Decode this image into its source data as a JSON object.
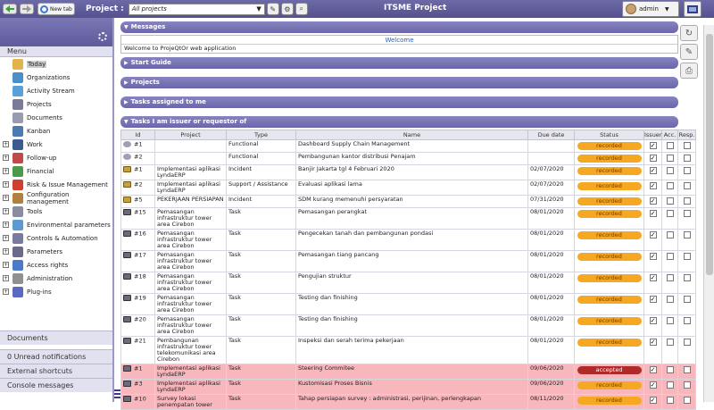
{
  "topbar": {
    "new_tab_label": "New tab",
    "project_label": "Project :",
    "project_value": "All projects",
    "app_title": "ITSME Project",
    "user_name": "admin"
  },
  "menu": {
    "title": "Menu",
    "items": [
      {
        "label": "Today",
        "icon": "today-icon",
        "expandable": false,
        "color": "#e2b34a"
      },
      {
        "label": "Organizations",
        "icon": "organizations-icon",
        "expandable": false,
        "color": "#4a8fc8"
      },
      {
        "label": "Activity Stream",
        "icon": "activity-stream-icon",
        "expandable": false,
        "color": "#5aa0d8"
      },
      {
        "label": "Projects",
        "icon": "projects-icon",
        "expandable": false,
        "color": "#7a7a9a"
      },
      {
        "label": "Documents",
        "icon": "documents-icon",
        "expandable": false,
        "color": "#9a9ab0"
      },
      {
        "label": "Kanban",
        "icon": "kanban-icon",
        "expandable": false,
        "color": "#4a7ab0"
      },
      {
        "label": "Work",
        "icon": "work-icon",
        "expandable": true,
        "color": "#3a5a90"
      },
      {
        "label": "Follow-up",
        "icon": "follow-up-icon",
        "expandable": true,
        "color": "#c04a4a"
      },
      {
        "label": "Financial",
        "icon": "financial-icon",
        "expandable": true,
        "color": "#4a9a4a"
      },
      {
        "label": "Risk & Issue Management",
        "icon": "risk-icon",
        "expandable": true,
        "color": "#d04030"
      },
      {
        "label": "Configuration management",
        "icon": "configuration-icon",
        "expandable": true,
        "color": "#b08040"
      },
      {
        "label": "Tools",
        "icon": "tools-icon",
        "expandable": true,
        "color": "#8a8aa0"
      },
      {
        "label": "Environmental parameters",
        "icon": "environmental-icon",
        "expandable": true,
        "color": "#5a9ad0"
      },
      {
        "label": "Controls & Automation",
        "icon": "controls-icon",
        "expandable": true,
        "color": "#7a7aa0"
      },
      {
        "label": "Parameters",
        "icon": "parameters-icon",
        "expandable": true,
        "color": "#6a6a8a"
      },
      {
        "label": "Access rights",
        "icon": "access-rights-icon",
        "expandable": true,
        "color": "#4a7ac8"
      },
      {
        "label": "Administration",
        "icon": "administration-icon",
        "expandable": true,
        "color": "#909090"
      },
      {
        "label": "Plug-ins",
        "icon": "plug-ins-icon",
        "expandable": true,
        "color": "#5a6ac0"
      }
    ]
  },
  "left_bottom": {
    "documents": "Documents",
    "unread": "0 Unread notifications",
    "shortcuts": "External shortcuts",
    "console": "Console messages"
  },
  "sections": {
    "messages": "Messages",
    "welcome": "Welcome",
    "welcome_text": "Welcome to ProjeQtOr web application",
    "start_guide": "Start Guide",
    "projects": "Projects",
    "tasks_assigned": "Tasks assigned to me",
    "tasks_issuer": "Tasks I am issuer or requestor of"
  },
  "table": {
    "headers": [
      "Id",
      "Project",
      "Type",
      "Name",
      "Due date",
      "Status",
      "Issuer",
      "Acc.",
      "Resp."
    ],
    "rows": [
      {
        "id": "#1",
        "icon": "functional",
        "project": "",
        "type": "Functional",
        "name": "Dashboard Supply Chain Management",
        "due": "",
        "status": "recorded",
        "issuer": true,
        "acc": false,
        "resp": false,
        "highlight": false
      },
      {
        "id": "#2",
        "icon": "functional",
        "project": "",
        "type": "Functional",
        "name": "Pembangunan kantor distribusi Penajam",
        "due": "",
        "status": "recorded",
        "issuer": true,
        "acc": false,
        "resp": false,
        "highlight": false
      },
      {
        "id": "#1",
        "icon": "incident",
        "project": "Implementasi aplikasi LyndaERP",
        "type": "Incident",
        "name": "Banjir Jakarta tgl 4 Februari 2020",
        "due": "02/07/2020",
        "status": "recorded",
        "issuer": true,
        "acc": false,
        "resp": false,
        "highlight": false
      },
      {
        "id": "#2",
        "icon": "incident",
        "project": "Implementasi aplikasi LyndaERP",
        "type": "Support / Assistance",
        "name": "Evaluasi aplikasi lama",
        "due": "02/07/2020",
        "status": "recorded",
        "issuer": true,
        "acc": false,
        "resp": false,
        "highlight": false
      },
      {
        "id": "#5",
        "icon": "incident",
        "project": "PEKERJAAN PERSIAPAN",
        "type": "Incident",
        "name": "SDM kurang memenuhi persyaratan",
        "due": "07/31/2020",
        "status": "recorded",
        "issuer": true,
        "acc": false,
        "resp": false,
        "highlight": false
      },
      {
        "id": "#15",
        "icon": "task",
        "project": "Pemasangan infrastruktur tower area Cirebon",
        "type": "Task",
        "name": "Pemasangan perangkat",
        "due": "08/01/2020",
        "status": "recorded",
        "issuer": true,
        "acc": false,
        "resp": false,
        "highlight": false
      },
      {
        "id": "#16",
        "icon": "task",
        "project": "Pemasangan infrastruktur tower area Cirebon",
        "type": "Task",
        "name": "Pengecekan tanah dan pembangunan pondasi",
        "due": "08/01/2020",
        "status": "recorded",
        "issuer": true,
        "acc": false,
        "resp": false,
        "highlight": false
      },
      {
        "id": "#17",
        "icon": "task",
        "project": "Pemasangan infrastruktur tower area Cirebon",
        "type": "Task",
        "name": "Pemasangan tiang pancang",
        "due": "08/01/2020",
        "status": "recorded",
        "issuer": true,
        "acc": false,
        "resp": false,
        "highlight": false
      },
      {
        "id": "#18",
        "icon": "task",
        "project": "Pemasangan infrastruktur tower area Cirebon",
        "type": "Task",
        "name": "Pengujian struktur",
        "due": "08/01/2020",
        "status": "recorded",
        "issuer": true,
        "acc": false,
        "resp": false,
        "highlight": false
      },
      {
        "id": "#19",
        "icon": "task",
        "project": "Pemasangan infrastruktur tower area Cirebon",
        "type": "Task",
        "name": "Testing dan finishing",
        "due": "08/01/2020",
        "status": "recorded",
        "issuer": true,
        "acc": false,
        "resp": false,
        "highlight": false
      },
      {
        "id": "#20",
        "icon": "task",
        "project": "Pemasangan infrastruktur tower area Cirebon",
        "type": "Task",
        "name": "Testing dan finishing",
        "due": "08/01/2020",
        "status": "recorded",
        "issuer": true,
        "acc": false,
        "resp": false,
        "highlight": false
      },
      {
        "id": "#21",
        "icon": "task",
        "project": "Pembangunan infrastruktur tower telekomunikasi area Cirebon",
        "type": "Task",
        "name": "Inspeksi dan serah terima pekerjaan",
        "due": "08/01/2020",
        "status": "recorded",
        "issuer": true,
        "acc": false,
        "resp": false,
        "highlight": false
      },
      {
        "id": "#1",
        "icon": "task",
        "project": "Implementasi aplikasi LyndaERP",
        "type": "Task",
        "name": "Steering Commitee",
        "due": "09/06/2020",
        "status": "accepted",
        "issuer": true,
        "acc": false,
        "resp": false,
        "highlight": true
      },
      {
        "id": "#3",
        "icon": "task",
        "project": "Implementasi aplikasi LyndaERP",
        "type": "Task",
        "name": "Kustomisasi Proses Bisnis",
        "due": "09/06/2020",
        "status": "recorded",
        "issuer": true,
        "acc": false,
        "resp": false,
        "highlight": true
      },
      {
        "id": "#10",
        "icon": "task",
        "project": "Survey lokasi penempatan tower",
        "type": "Task",
        "name": "Tahap persiapan survey : administrasi, perijinan, perlengkapan",
        "due": "08/11/2020",
        "status": "recorded",
        "issuer": true,
        "acc": false,
        "resp": false,
        "highlight": true
      }
    ]
  }
}
